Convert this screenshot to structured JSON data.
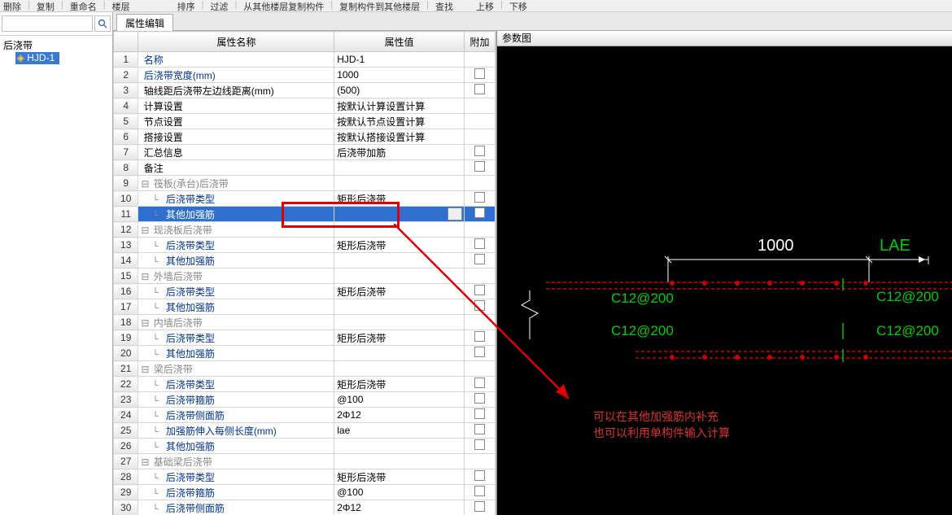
{
  "toolbar": {
    "items": [
      "删除",
      "复制",
      "重命名",
      "楼层",
      "排序",
      "过滤",
      "从其他楼层复制构件",
      "复制构件到其他楼层",
      "查找",
      "上移",
      "下移"
    ]
  },
  "tree": {
    "root": "后浇带",
    "item": "HJD-1"
  },
  "tab": {
    "active": "属性编辑"
  },
  "gridHeader": {
    "name": "属性名称",
    "value": "属性值",
    "attach": "附加"
  },
  "rows": [
    {
      "n": "1",
      "name": "名称",
      "blue": true,
      "indent": 0,
      "val": "HJD-1",
      "chk": false
    },
    {
      "n": "2",
      "name": "后浇带宽度(mm)",
      "blue": true,
      "indent": 0,
      "val": "1000",
      "chk": true
    },
    {
      "n": "3",
      "name": "轴线距后浇带左边线距离(mm)",
      "blue": false,
      "indent": 0,
      "val": "(500)",
      "chk": true
    },
    {
      "n": "4",
      "name": "计算设置",
      "blue": false,
      "indent": 0,
      "val": "按默认计算设置计算",
      "chk": false
    },
    {
      "n": "5",
      "name": "节点设置",
      "blue": false,
      "indent": 0,
      "val": "按默认节点设置计算",
      "chk": false
    },
    {
      "n": "6",
      "name": "搭接设置",
      "blue": false,
      "indent": 0,
      "val": "按默认搭接设置计算",
      "chk": false
    },
    {
      "n": "7",
      "name": "汇总信息",
      "blue": false,
      "indent": 0,
      "val": "后浇带加筋",
      "chk": true
    },
    {
      "n": "8",
      "name": "备注",
      "blue": false,
      "indent": 0,
      "val": "",
      "chk": true
    },
    {
      "n": "9",
      "name": "筏板(承台)后浇带",
      "group": true,
      "indent": 0
    },
    {
      "n": "10",
      "name": "后浇带类型",
      "blue": true,
      "indent": 1,
      "val": "矩形后浇带",
      "chk": true
    },
    {
      "n": "11",
      "name": "其他加强筋",
      "blue": true,
      "indent": 1,
      "val": "",
      "chk": true,
      "selected": true,
      "more": true
    },
    {
      "n": "12",
      "name": "现浇板后浇带",
      "group": true,
      "indent": 0
    },
    {
      "n": "13",
      "name": "后浇带类型",
      "blue": true,
      "indent": 1,
      "val": "矩形后浇带",
      "chk": true
    },
    {
      "n": "14",
      "name": "其他加强筋",
      "blue": true,
      "indent": 1,
      "val": "",
      "chk": true
    },
    {
      "n": "15",
      "name": "外墙后浇带",
      "group": true,
      "indent": 0
    },
    {
      "n": "16",
      "name": "后浇带类型",
      "blue": true,
      "indent": 1,
      "val": "矩形后浇带",
      "chk": true
    },
    {
      "n": "17",
      "name": "其他加强筋",
      "blue": true,
      "indent": 1,
      "val": "",
      "chk": true
    },
    {
      "n": "18",
      "name": "内墙后浇带",
      "group": true,
      "indent": 0
    },
    {
      "n": "19",
      "name": "后浇带类型",
      "blue": true,
      "indent": 1,
      "val": "矩形后浇带",
      "chk": true
    },
    {
      "n": "20",
      "name": "其他加强筋",
      "blue": true,
      "indent": 1,
      "val": "",
      "chk": true
    },
    {
      "n": "21",
      "name": "梁后浇带",
      "group": true,
      "indent": 0
    },
    {
      "n": "22",
      "name": "后浇带类型",
      "blue": true,
      "indent": 1,
      "val": "矩形后浇带",
      "chk": true
    },
    {
      "n": "23",
      "name": "后浇带箍筋",
      "blue": true,
      "indent": 1,
      "val": "@100",
      "chk": true
    },
    {
      "n": "24",
      "name": "后浇带侧面筋",
      "blue": true,
      "indent": 1,
      "val": "2Φ12",
      "chk": true
    },
    {
      "n": "25",
      "name": "加强筋伸入每侧长度(mm)",
      "blue": true,
      "indent": 1,
      "val": "lae",
      "chk": true
    },
    {
      "n": "26",
      "name": "其他加强筋",
      "blue": true,
      "indent": 1,
      "val": "",
      "chk": true
    },
    {
      "n": "27",
      "name": "基础梁后浇带",
      "group": true,
      "indent": 0
    },
    {
      "n": "28",
      "name": "后浇带类型",
      "blue": true,
      "indent": 1,
      "val": "矩形后浇带",
      "chk": true
    },
    {
      "n": "29",
      "name": "后浇带箍筋",
      "blue": true,
      "indent": 1,
      "val": "@100",
      "chk": true
    },
    {
      "n": "30",
      "name": "后浇带侧面筋",
      "blue": true,
      "indent": 1,
      "val": "2Φ12",
      "chk": true
    }
  ],
  "preview": {
    "title": "参数图",
    "dim": "1000",
    "lae": "LAE",
    "rebar": "C12@200"
  },
  "annotation": {
    "line1": "可以在其他加强筋内补充",
    "line2": "也可以利用单构件输入计算"
  }
}
